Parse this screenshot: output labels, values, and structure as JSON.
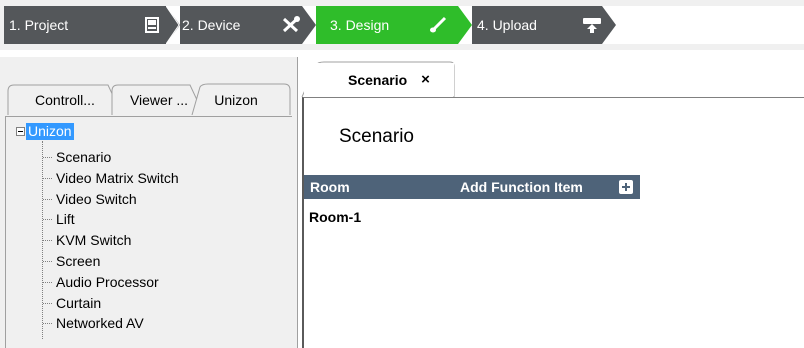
{
  "steps": [
    {
      "label": "1. Project",
      "icon": "save-icon",
      "active": false
    },
    {
      "label": "2. Device",
      "icon": "tools-icon",
      "active": false
    },
    {
      "label": "3. Design",
      "icon": "brush-icon",
      "active": true
    },
    {
      "label": "4. Upload",
      "icon": "upload-icon",
      "active": false
    }
  ],
  "colors": {
    "step_bg": "#54575a",
    "step_active": "#2fbd2a",
    "table_header": "#4e6379",
    "selection": "#3399ff"
  },
  "panel_tabs": [
    {
      "label": "Controll...",
      "active": false
    },
    {
      "label": "Viewer ...",
      "active": false
    },
    {
      "label": "Unizon",
      "active": true
    }
  ],
  "tree": {
    "root": "Unizon",
    "items": [
      "Scenario",
      "Video Matrix Switch",
      "Video Switch",
      "Lift",
      "KVM Switch",
      "Screen",
      "Audio Processor",
      "Curtain",
      "Networked AV"
    ]
  },
  "document_tab": {
    "title": "Scenario",
    "close": "×"
  },
  "content": {
    "title": "Scenario",
    "table": {
      "columns": [
        "Room",
        "Add Function Item"
      ],
      "rows": [
        "Room-1"
      ]
    }
  }
}
